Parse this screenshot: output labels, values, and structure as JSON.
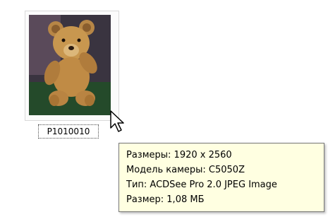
{
  "file": {
    "name": "P1010010",
    "thumbnail_icon": "teddy-bear-photo"
  },
  "tooltip": {
    "lines": [
      "Размеры: 1920 x 2560",
      "Модель камеры: C5050Z",
      "Тип: ACDSee Pro 2.0 JPEG Image",
      "Размер: 1,08 МБ"
    ]
  },
  "cursor": {
    "icon": "arrow-pointer-icon"
  }
}
